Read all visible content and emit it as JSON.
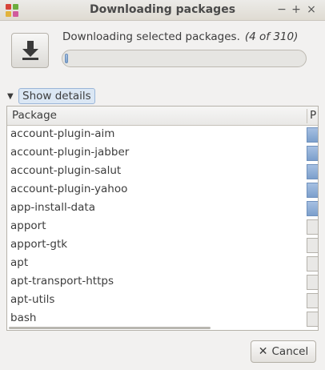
{
  "window": {
    "title": "Downloading packages",
    "controls": {
      "minimize": "−",
      "maximize": "+",
      "close": "×"
    }
  },
  "header": {
    "icon": "download-arrow-icon",
    "status_text": "Downloading selected packages.",
    "count_text": "(4 of 310)",
    "progress_fraction": 0.013
  },
  "expander": {
    "arrow": "▼",
    "label": "Show details"
  },
  "list": {
    "columns": {
      "package": "Package",
      "progress": "P"
    },
    "rows": [
      {
        "name": "account-plugin-aim",
        "done": true
      },
      {
        "name": "account-plugin-jabber",
        "done": true
      },
      {
        "name": "account-plugin-salut",
        "done": true
      },
      {
        "name": "account-plugin-yahoo",
        "done": true
      },
      {
        "name": "app-install-data",
        "done": true
      },
      {
        "name": "apport",
        "done": false
      },
      {
        "name": "apport-gtk",
        "done": false
      },
      {
        "name": "apt",
        "done": false
      },
      {
        "name": "apt-transport-https",
        "done": false
      },
      {
        "name": "apt-utils",
        "done": false
      },
      {
        "name": "bash",
        "done": false
      }
    ]
  },
  "cancel": {
    "label": "Cancel",
    "icon": "close-x-icon"
  },
  "colors": {
    "progress_fill": "#7fa2cc",
    "accent_border": "#9ab6d8"
  }
}
